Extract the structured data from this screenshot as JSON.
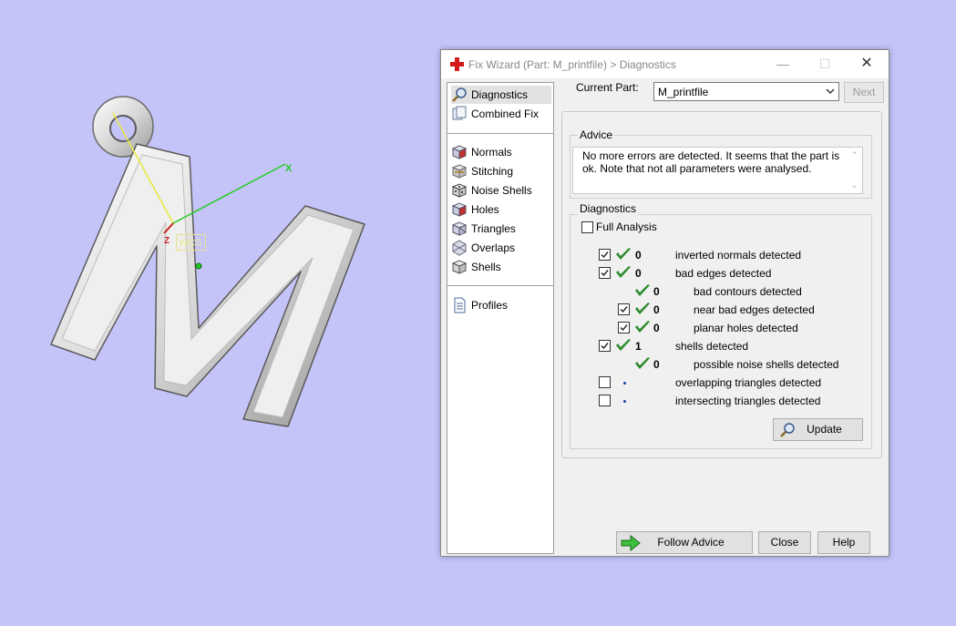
{
  "viewport": {
    "axis_x": "X",
    "axis_z": "Z",
    "wcs": "WCS"
  },
  "dialog": {
    "title": "Fix Wizard (Part: M_printfile) > Diagnostics",
    "nav": [
      {
        "label": "Diagnostics",
        "icon": "magnifier-icon"
      },
      {
        "label": "Combined Fix",
        "icon": "combined-fix-icon"
      },
      {
        "label": "Normals",
        "icon": "normals-cube-icon"
      },
      {
        "label": "Stitching",
        "icon": "stitching-icon"
      },
      {
        "label": "Noise Shells",
        "icon": "noise-shells-icon"
      },
      {
        "label": "Holes",
        "icon": "holes-icon"
      },
      {
        "label": "Triangles",
        "icon": "triangles-icon"
      },
      {
        "label": "Overlaps",
        "icon": "overlaps-icon"
      },
      {
        "label": "Shells",
        "icon": "shells-icon"
      },
      {
        "label": "Profiles",
        "icon": "profiles-icon"
      }
    ],
    "current_part_label": "Current Part:",
    "current_part_value": "M_printfile",
    "next_label": "Next",
    "advice": {
      "title": "Advice",
      "text": "No more errors are detected. It seems that the part is ok. Note that not all parameters were analysed."
    },
    "diagnostics": {
      "title": "Diagnostics",
      "full_analysis": "Full Analysis",
      "rows": [
        {
          "checked": true,
          "has_checkbox": true,
          "status": "ok",
          "count": "0",
          "label": "inverted normals detected"
        },
        {
          "checked": true,
          "has_checkbox": true,
          "status": "ok",
          "count": "0",
          "label": "bad edges detected"
        },
        {
          "checked": false,
          "has_checkbox": false,
          "status": "ok",
          "count": "0",
          "label": "bad contours detected"
        },
        {
          "checked": true,
          "has_checkbox": true,
          "status": "ok",
          "count": "0",
          "label": "near bad edges detected"
        },
        {
          "checked": true,
          "has_checkbox": true,
          "status": "ok",
          "count": "0",
          "label": "planar holes detected"
        },
        {
          "checked": true,
          "has_checkbox": true,
          "status": "ok",
          "count": "1",
          "label": "shells detected"
        },
        {
          "checked": false,
          "has_checkbox": false,
          "status": "ok",
          "count": "0",
          "label": "possible noise shells detected"
        },
        {
          "checked": false,
          "has_checkbox": true,
          "status": "none",
          "count": "",
          "label": "overlapping triangles detected"
        },
        {
          "checked": false,
          "has_checkbox": true,
          "status": "none",
          "count": "",
          "label": "intersecting triangles detected"
        }
      ],
      "update_label": "Update"
    },
    "footer": {
      "follow_advice": "Follow Advice",
      "close": "Close",
      "help": "Help"
    }
  },
  "colors": {
    "background": "#c4c4f9",
    "tick_green": "#2e8b2e",
    "axis_x": "#22cc22",
    "axis_y": "#e8e840",
    "axis_z": "#cc2222"
  }
}
